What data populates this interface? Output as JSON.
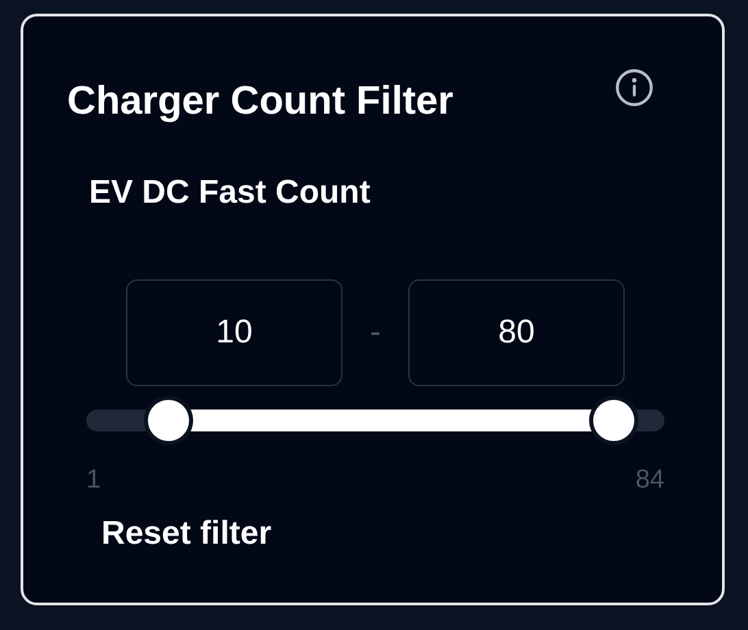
{
  "card": {
    "title": "Charger Count Filter"
  },
  "filter": {
    "label": "EV DC Fast Count",
    "min_value": "10",
    "separator": "-",
    "max_value": "80"
  },
  "slider": {
    "thumbs": [
      {
        "level": 0.108
      },
      {
        "level": 0.952
      }
    ],
    "min_label": "1",
    "max_label": "84"
  },
  "reset_link": "Reset filter"
}
